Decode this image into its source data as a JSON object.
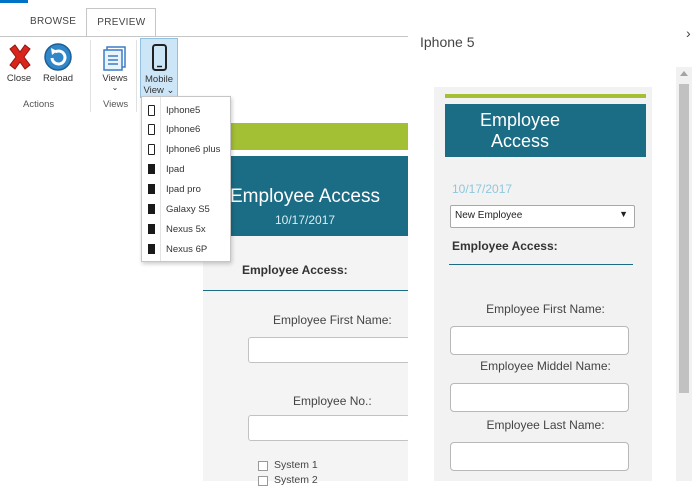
{
  "ribbon": {
    "tabs": [
      "BROWSE",
      "PREVIEW"
    ],
    "buttons": {
      "close": "Close",
      "reload": "Reload",
      "views": "Views",
      "mobile_view_line1": "Mobile",
      "mobile_view_line2": "View ⌄"
    },
    "groups": {
      "actions": "Actions",
      "views": "Views"
    },
    "colors": {
      "accent": "#0072c6",
      "selected": "#cde6f7"
    }
  },
  "menu": {
    "items": [
      "Iphone5",
      "Iphone6",
      "Iphone6 plus",
      "Ipad",
      "Ipad pro",
      "Galaxy S5",
      "Nexus 5x",
      "Nexus 6P"
    ]
  },
  "background_form": {
    "title": "Employee Access",
    "date": "10/17/2017",
    "section": "Employee Access:",
    "first_name_label": "Employee First Name:",
    "employee_no_label": "Employee No.:",
    "systems": [
      "System 1",
      "System 2"
    ],
    "colors": {
      "header": "#1b6c85",
      "band": "#a3bf33"
    }
  },
  "panel": {
    "title": "Iphone 5",
    "close_glyph": "›",
    "form": {
      "title_line1": "Employee",
      "title_line2": "Access",
      "date": "10/17/2017",
      "select_value": "New Employee",
      "select_arrow": "▼",
      "section": "Employee Access:",
      "first_name_label": "Employee First Name:",
      "middle_name_label": "Employee Middel Name:",
      "last_name_label": "Employee Last Name:"
    }
  }
}
